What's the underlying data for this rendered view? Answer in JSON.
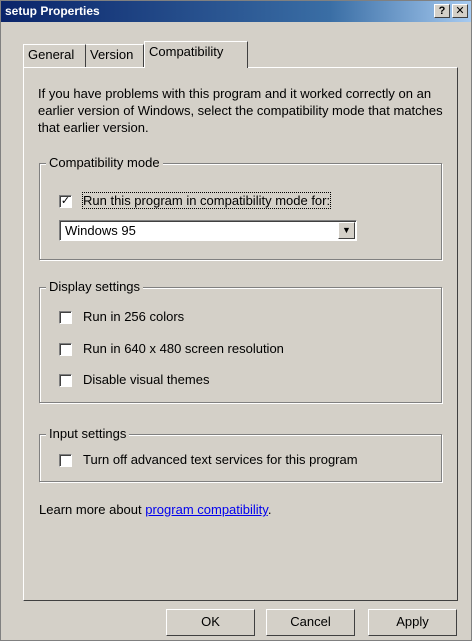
{
  "window": {
    "title": "setup Properties",
    "help_label": "?",
    "close_label": "✕"
  },
  "tabs": [
    {
      "label": "General"
    },
    {
      "label": "Version"
    },
    {
      "label": "Compatibility",
      "active": true
    }
  ],
  "intro_text": "If you have problems with this program and it worked correctly on an earlier version of Windows, select the compatibility mode that matches that earlier version.",
  "compatibility_mode": {
    "legend": "Compatibility mode",
    "checkbox_label": "Run this program in compatibility mode for:",
    "checked": true,
    "selected_os": "Windows 95"
  },
  "display_settings": {
    "legend": "Display settings",
    "options": [
      {
        "label": "Run in 256 colors",
        "checked": false
      },
      {
        "label": "Run in 640 x 480 screen resolution",
        "checked": false
      },
      {
        "label": "Disable visual themes",
        "checked": false
      }
    ]
  },
  "input_settings": {
    "legend": "Input settings",
    "options": [
      {
        "label": "Turn off advanced text services for this program",
        "checked": false
      }
    ]
  },
  "learn_more": {
    "prefix": "Learn more about ",
    "link": "program compatibility",
    "suffix": "."
  },
  "buttons": {
    "ok": "OK",
    "cancel": "Cancel",
    "apply": "Apply"
  },
  "check_glyph": "✓"
}
